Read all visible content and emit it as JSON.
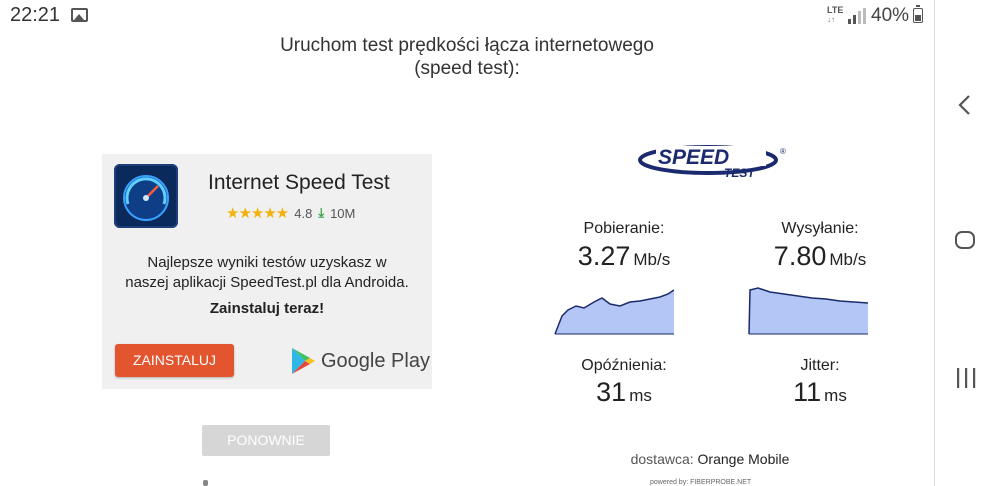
{
  "status_bar": {
    "time": "22:21",
    "network": "LTE",
    "battery_percent": "40%"
  },
  "page_title": {
    "line1": "Uruchom test prędkości łącza internetowego",
    "line2": "(speed test):"
  },
  "ad": {
    "app_name": "Internet Speed Test",
    "rating": "4.8",
    "downloads": "10M",
    "description_line1": "Najlepsze wyniki testów uzyskasz w",
    "description_line2": "naszej aplikacji SpeedTest.pl dla Androida.",
    "cta": "Zainstaluj teraz!",
    "install_label": "ZAINSTALUJ",
    "store_label": "Google Play"
  },
  "retry_label": "PONOWNIE",
  "logo": {
    "word1": "SPEED",
    "word2": "TEST",
    "mark": "®"
  },
  "results": {
    "download": {
      "label": "Pobieranie:",
      "value": "3.27",
      "unit": "Mb/s"
    },
    "upload": {
      "label": "Wysyłanie:",
      "value": "7.80",
      "unit": "Mb/s"
    },
    "latency": {
      "label": "Opóźnienia:",
      "value": "31",
      "unit": "ms"
    },
    "jitter": {
      "label": "Jitter:",
      "value": "11",
      "unit": "ms"
    }
  },
  "provider": {
    "label": "dostawca:",
    "name": "Orange Mobile"
  },
  "powered_by": "powered by: FIBERPROBE.NET",
  "colors": {
    "install_button": "#e2552f",
    "spark_fill": "#b3c6f5",
    "spark_line": "#1a2a6c",
    "star": "#f2b20d",
    "logo": "#1b2a6e"
  },
  "icons": {
    "gallery": "image-icon",
    "signal": "signal-icon",
    "battery": "battery-icon",
    "back": "back-chevron-icon",
    "home": "home-icon",
    "recent": "recent-apps-icon",
    "download": "download-arrow-icon",
    "play": "google-play-icon"
  }
}
